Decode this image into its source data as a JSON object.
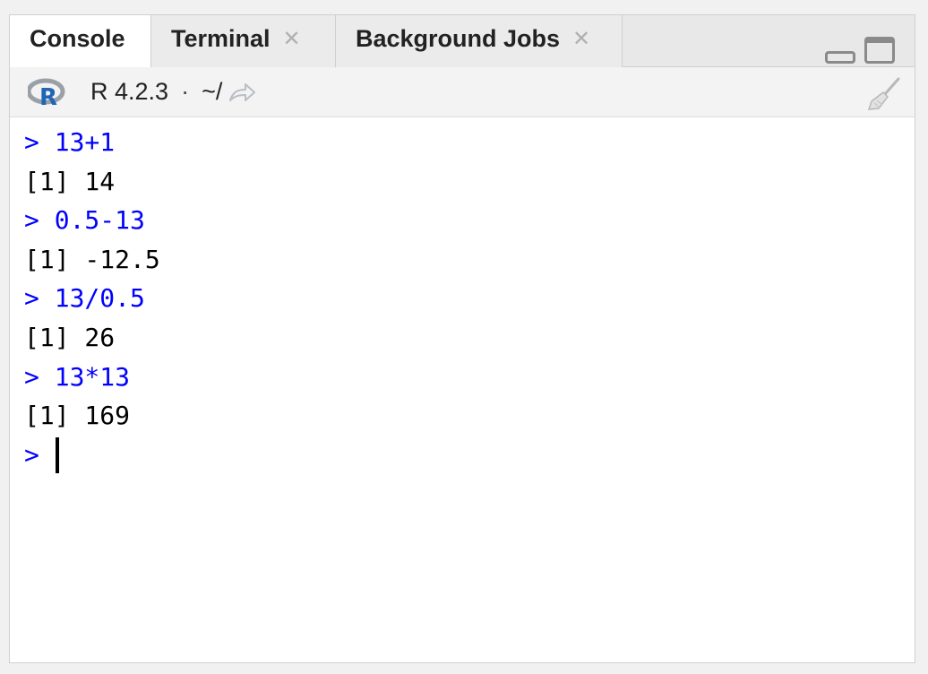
{
  "tabs": [
    {
      "label": "Console",
      "active": true,
      "closable": false
    },
    {
      "label": "Terminal",
      "active": false,
      "closable": true
    },
    {
      "label": "Background Jobs",
      "active": false,
      "closable": true
    }
  ],
  "toolbar": {
    "r_version": "R 4.2.3",
    "separator": "·",
    "working_dir": "~/",
    "logo": "r-logo-icon",
    "goto_icon": "goto-directory-icon",
    "clear_icon": "broom-icon"
  },
  "console": {
    "lines": [
      {
        "type": "command",
        "text": "> 13+1"
      },
      {
        "type": "output",
        "text": "[1] 14"
      },
      {
        "type": "command",
        "text": "> 0.5-13"
      },
      {
        "type": "output",
        "text": "[1] -12.5"
      },
      {
        "type": "command",
        "text": "> 13/0.5"
      },
      {
        "type": "output",
        "text": "[1] 26"
      },
      {
        "type": "command",
        "text": "> 13*13"
      },
      {
        "type": "output",
        "text": "[1] 169"
      }
    ],
    "prompt": ">"
  },
  "colors": {
    "command": "#0000ff",
    "output": "#000000",
    "r_logo_ring": "#9aa0a8",
    "r_logo_letter": "#2166b5"
  }
}
